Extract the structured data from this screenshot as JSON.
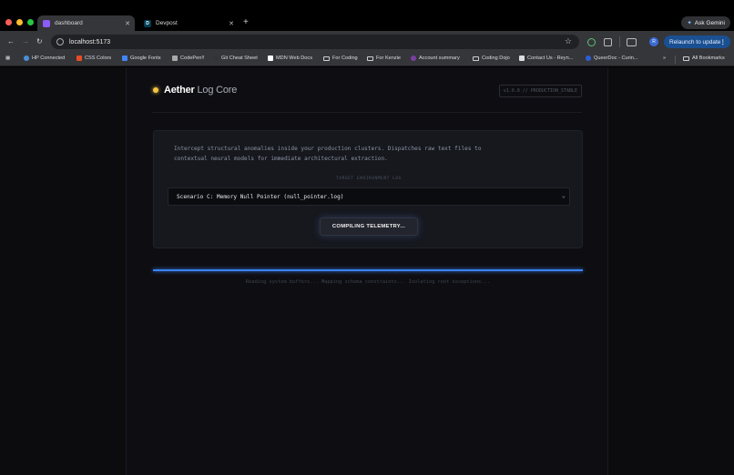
{
  "browser": {
    "tabs": [
      {
        "title": "dashboard",
        "favicon": "vite-icon",
        "active": true
      },
      {
        "title": "Devpost",
        "favicon_letter": "D",
        "active": false
      }
    ],
    "url": "localhost:5173",
    "gemini_label": "Ask Gemini",
    "relaunch_label": "Relaunch to update",
    "avatar_letter": "R",
    "bookmarks": [
      {
        "label": "HP Connected",
        "icon": "globe-icon"
      },
      {
        "label": "CSS Colors",
        "icon": "css-icon"
      },
      {
        "label": "Google Fonts",
        "icon": "fonts-icon"
      },
      {
        "label": "CodePen!!",
        "icon": "codepen-icon"
      },
      {
        "label": "Git Cheat Sheet",
        "icon": "github-icon"
      },
      {
        "label": "MDN Web Docs",
        "icon": "mdn-icon"
      },
      {
        "label": "For Coding",
        "icon": "folder-icon"
      },
      {
        "label": "For Kenzie",
        "icon": "folder-icon"
      },
      {
        "label": "Account summary",
        "icon": "account-icon"
      },
      {
        "label": "Coding Dojo",
        "icon": "folder-icon"
      },
      {
        "label": "Contact Us - Reyn...",
        "icon": "contact-icon"
      },
      {
        "label": "QueerDoc - Curin...",
        "icon": "queerdoc-icon"
      }
    ],
    "all_bookmarks_label": "All Bookmarks"
  },
  "app": {
    "brand_bold": "Aether",
    "brand_light": "Log Core",
    "version": "v1.0.0 // PRODUCTION_STABLE",
    "description": "Intercept structural anomalies inside your production clusters. Dispatches raw text files to contextual neural models for immediate architectural extraction.",
    "environment_label": "TARGET ENVIRONMENT LOG",
    "selected_log": "Scenario C: Memory Null Pointer (null_pointer.log)",
    "compile_button": "COMPILING TELEMETRY...",
    "progress": 1.0,
    "status_text": "Reading system buffers... Mapping schema constraints... Isolating root exceptions...",
    "accent_color": "#3b82f6",
    "status_dot_color": "#f5c542"
  }
}
